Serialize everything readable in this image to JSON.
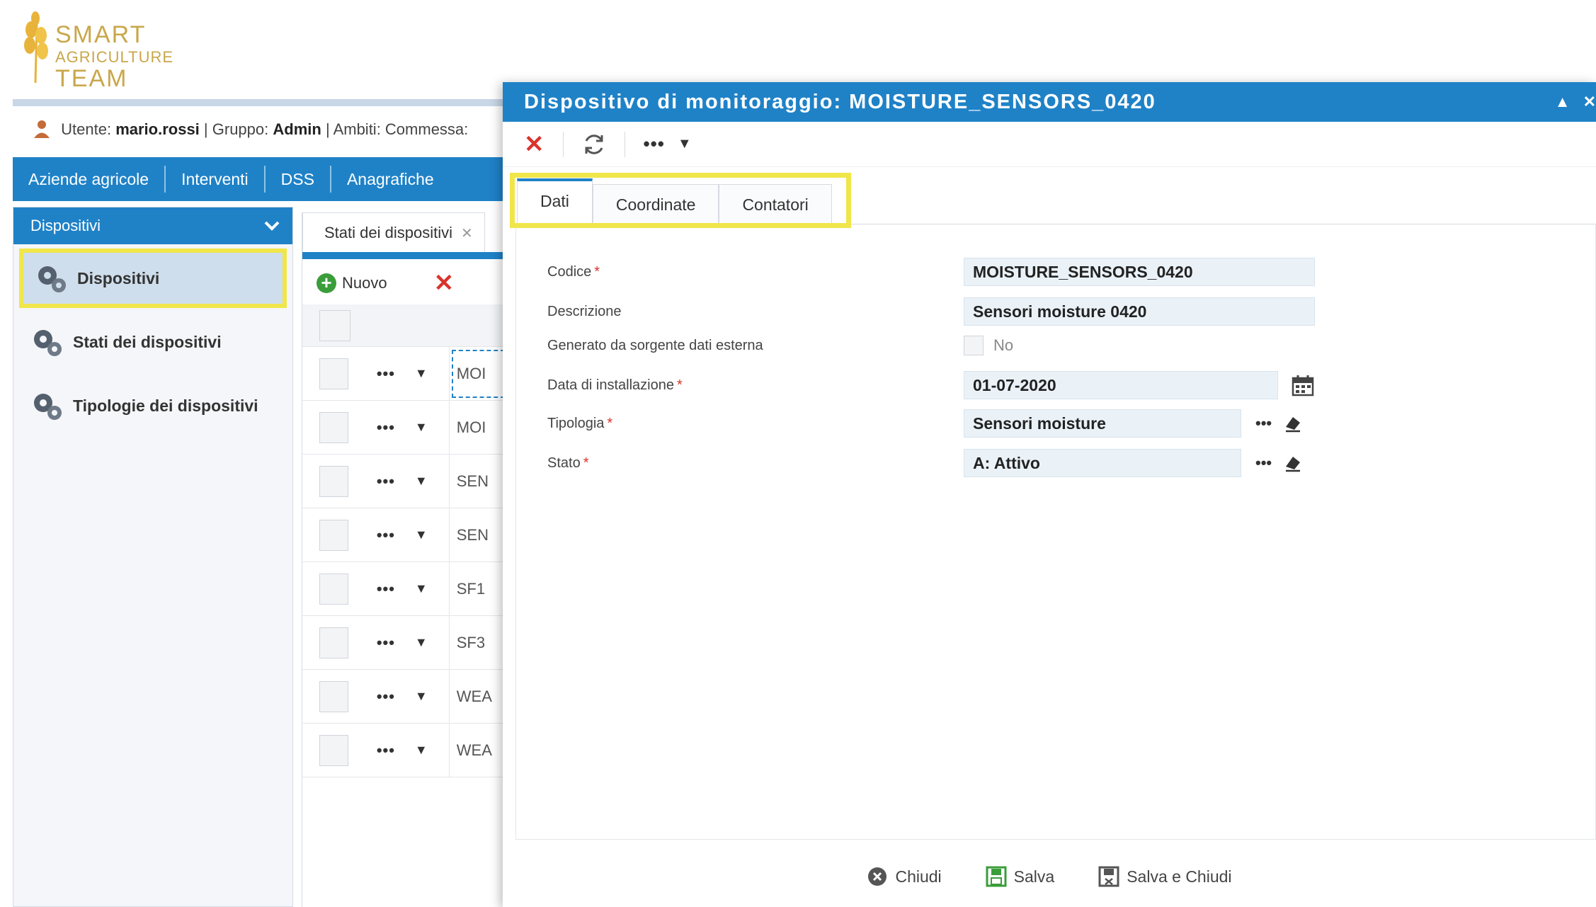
{
  "logo": {
    "line1": "SMART",
    "line2": "AGRICULTURE",
    "line3": "TEAM"
  },
  "userbar": {
    "user_label": "Utente:",
    "user": "mario.rossi",
    "group_label": "| Gruppo:",
    "group": "Admin",
    "scope_label": "| Ambiti: Commessa:"
  },
  "menu": {
    "items": [
      "Aziende agricole",
      "Interventi",
      "DSS",
      "Anagrafiche"
    ]
  },
  "sidebar": {
    "header": "Dispositivi",
    "items": [
      {
        "label": "Dispositivi"
      },
      {
        "label": "Stati dei dispositivi"
      },
      {
        "label": "Tipologie dei dispositivi"
      }
    ]
  },
  "background_panel": {
    "tab_label": "Stati dei dispositivi",
    "new_label": "Nuovo",
    "rows": [
      "MOI",
      "MOI",
      "SEN",
      "SEN",
      "SF1",
      "SF3",
      "WEA",
      "WEA"
    ]
  },
  "modal": {
    "title": "Dispositivo di monitoraggio: MOISTURE_SENSORS_0420",
    "tabs": [
      "Dati",
      "Coordinate",
      "Contatori"
    ],
    "fields": {
      "codice": {
        "label": "Codice",
        "value": "MOISTURE_SENSORS_0420"
      },
      "descrizione": {
        "label": "Descrizione",
        "value": "Sensori moisture 0420"
      },
      "generato": {
        "label": "Generato da sorgente dati esterna",
        "value": "No"
      },
      "data": {
        "label": "Data di installazione",
        "value": "01-07-2020"
      },
      "tipologia": {
        "label": "Tipologia",
        "value": "Sensori moisture"
      },
      "stato": {
        "label": "Stato",
        "value": "A: Attivo"
      }
    },
    "footer": {
      "close": "Chiudi",
      "save": "Salva",
      "save_close": "Salva e Chiudi"
    }
  },
  "colors": {
    "brand_blue": "#1f82c7",
    "highlight_yellow": "#f0e64a",
    "delete_red": "#d9342b",
    "input_bg": "#eaf2f8"
  }
}
